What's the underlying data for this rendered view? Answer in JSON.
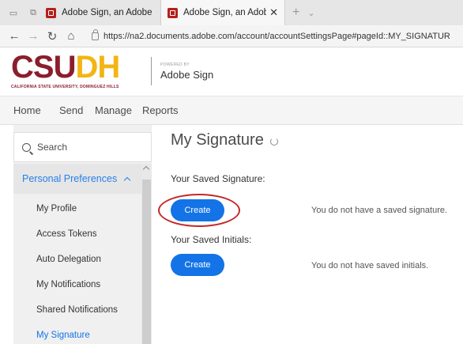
{
  "browser": {
    "tabs": [
      {
        "title": "Adobe Sign, an Adobe Docu",
        "active": false
      },
      {
        "title": "Adobe Sign, an Adobe I",
        "active": true
      }
    ],
    "url": "https://na2.documents.adobe.com/account/accountSettingsPage#pageId::MY_SIGNATUR"
  },
  "brand": {
    "logo_part1": "CSU",
    "logo_part2": "DH",
    "logo_subtitle": "CALIFORNIA STATE UNIVERSITY, DOMINGUEZ HILLS",
    "powered_by": "POWERED BY",
    "product": "Adobe Sign"
  },
  "nav": {
    "items": [
      "Home",
      "Send",
      "Manage",
      "Reports"
    ]
  },
  "sidebar": {
    "search_placeholder": "Search",
    "section": "Personal Preferences",
    "items": [
      "My Profile",
      "Access Tokens",
      "Auto Delegation",
      "My Notifications",
      "Shared Notifications",
      "My Signature"
    ],
    "selected": "My Signature"
  },
  "content": {
    "title": "My Signature",
    "saved_signature_label": "Your Saved Signature:",
    "create_label": "Create",
    "no_signature_msg": "You do not have a saved signature.",
    "saved_initials_label": "Your Saved Initials:",
    "no_initials_msg": "You do not have saved initials."
  },
  "colors": {
    "accent": "#1473e6",
    "highlight_circle": "#c62828",
    "brand_primary": "#8c1d2c",
    "brand_secondary": "#f2b514"
  }
}
